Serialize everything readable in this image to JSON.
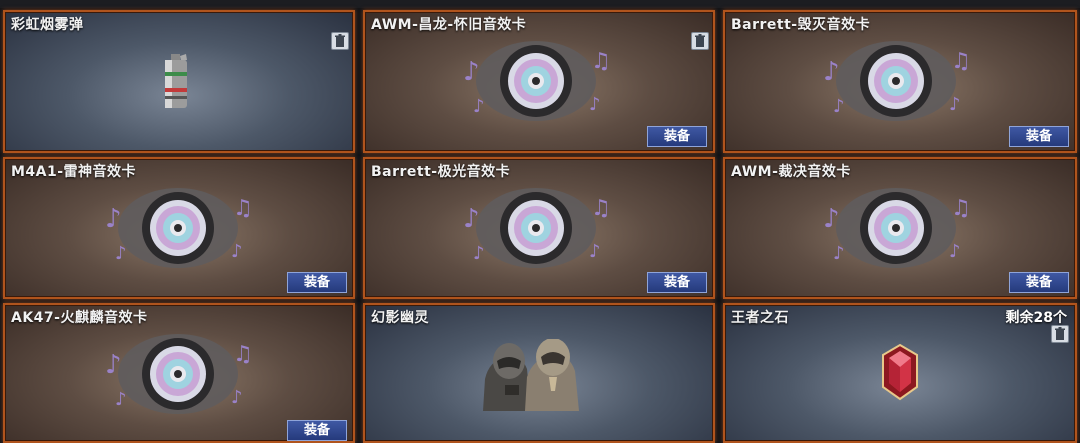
{
  "items": [
    {
      "title": "彩虹烟雾弹",
      "art": "smoke-grenade-icon",
      "has_trash": true
    },
    {
      "title": "AWM-昌龙-怀旧音效卡",
      "art": "sound-card-disc-icon",
      "has_trash": true,
      "equip_label": "装备"
    },
    {
      "title": "Barrett-毁灭音效卡",
      "art": "sound-card-disc-icon",
      "equip_label": "装备"
    },
    {
      "title": "M4A1-雷神音效卡",
      "art": "sound-card-disc-icon",
      "equip_label": "装备"
    },
    {
      "title": "Barrett-极光音效卡",
      "art": "sound-card-disc-icon",
      "equip_label": "装备"
    },
    {
      "title": "AWM-裁决音效卡",
      "art": "sound-card-disc-icon",
      "equip_label": "装备"
    },
    {
      "title": "AK47-火麒麟音效卡",
      "art": "sound-card-disc-icon",
      "equip_label": "装备"
    },
    {
      "title": "幻影幽灵",
      "art": "phantom-ghost-characters-icon"
    },
    {
      "title": "王者之石",
      "art": "kings-stone-gem-icon",
      "count": "剩余28个",
      "has_trash": true
    }
  ],
  "colors": {
    "card_border": "#b0541d",
    "equip_button": "#2f4790",
    "title_text": "#f2f2f2"
  }
}
